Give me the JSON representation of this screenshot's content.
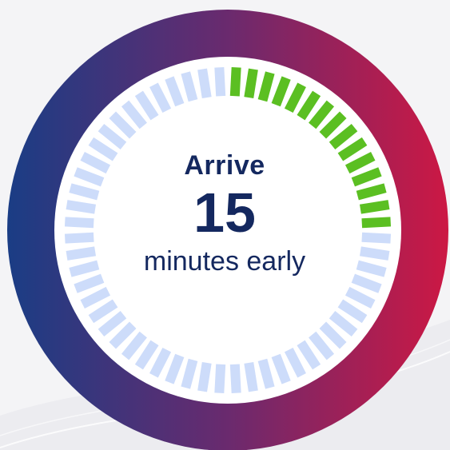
{
  "message": {
    "line_top": "Arrive",
    "number": "15",
    "line_bottom": "minutes early"
  },
  "dial": {
    "total_segments": 60,
    "highlighted_segments": 15,
    "highlight_color": "#5bbf22",
    "inactive_color": "#cddcfa"
  },
  "colors": {
    "ring_left": "#1a3d85",
    "ring_mid": "#6a2a6e",
    "ring_right": "#cc1844",
    "text": "#14285f",
    "background": "#f4f4f6"
  }
}
